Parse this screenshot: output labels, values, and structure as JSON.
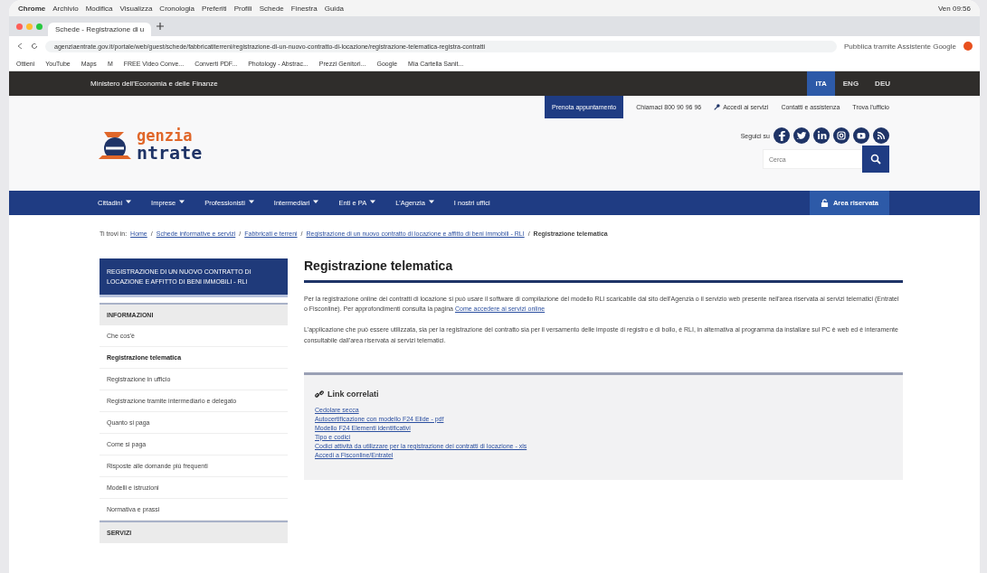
{
  "browser": {
    "menu": [
      "Chrome",
      "Archivio",
      "Modifica",
      "Visualizza",
      "Cronologia",
      "Preferiti",
      "Profili",
      "Schede",
      "Finestra",
      "Guida"
    ],
    "clock": "Ven 09:56",
    "tab_title": "Schede - Registrazione di u",
    "url": "agenziaentrate.gov.it/portale/web/guest/schede/fabbricatiterreni/registrazione-di-un-nuovo-contratto-di-locazione/registrazione-telematica-registra-contratti",
    "url_note": "Pubblica tramite Assistente Google",
    "bookmarks": [
      "Ottieni",
      "YouTube",
      "Maps",
      "M",
      "FREE Video Conve...",
      "Converti PDF...",
      "Photology - Abstrac...",
      "Prezzi Genitori...",
      "Google",
      "Mia Cartella Sanit..."
    ]
  },
  "top_bar": {
    "ministry": "Ministero dell'Economia e delle Finanze",
    "languages": [
      {
        "label": "ITA",
        "selected": true
      },
      {
        "label": "ENG",
        "selected": false
      },
      {
        "label": "DEU",
        "selected": false
      }
    ]
  },
  "header": {
    "logo_top": "genzia",
    "logo_bottom": "ntrate",
    "links": [
      {
        "label": "Prenota appuntamento",
        "kind": "primary"
      },
      {
        "label": "Chiamaci 800 90 96 96",
        "kind": "plain"
      },
      {
        "label": "Accedi ai servizi",
        "kind": "key"
      },
      {
        "label": "Contatti e assistenza",
        "kind": "plain"
      },
      {
        "label": "Trova l'ufficio",
        "kind": "plain"
      }
    ],
    "follow_label": "Seguici su",
    "search_placeholder": "Cerca"
  },
  "nav": {
    "items": [
      {
        "label": "Cittadini",
        "dropdown": true
      },
      {
        "label": "Imprese",
        "dropdown": true
      },
      {
        "label": "Professionisti",
        "dropdown": true
      },
      {
        "label": "Intermediari",
        "dropdown": true
      },
      {
        "label": "Enti e PA",
        "dropdown": true
      },
      {
        "label": "L'Agenzia",
        "dropdown": true
      },
      {
        "label": "I nostri uffici",
        "dropdown": false
      }
    ],
    "reserved": "Area riservata"
  },
  "breadcrumb": {
    "prefix": "Ti trovi in:",
    "separator": "/",
    "items": [
      "Home",
      "Schede informative e servizi",
      "Fabbricati e terreni",
      "Registrazione di un nuovo contratto di locazione e affitto di beni immobili - RLI",
      "Registrazione telematica"
    ]
  },
  "sidebar": {
    "title": "REGISTRAZIONE DI UN NUOVO CONTRATTO DI LOCAZIONE E AFFITTO DI BENI IMMOBILI - RLI",
    "sections": [
      {
        "heading": "INFORMAZIONI",
        "items": [
          {
            "label": "Che cos'è",
            "selected": false
          },
          {
            "label": "Registrazione telematica",
            "selected": true
          },
          {
            "label": "Registrazione in ufficio",
            "selected": false
          },
          {
            "label": "Registrazione tramite intermediario e delegato",
            "selected": false
          },
          {
            "label": "Quanto si paga",
            "selected": false
          },
          {
            "label": "Come si paga",
            "selected": false
          },
          {
            "label": "Risposte alle domande più frequenti",
            "selected": false
          },
          {
            "label": "Modelli e istruzioni",
            "selected": false
          },
          {
            "label": "Normativa e prassi",
            "selected": false
          }
        ]
      },
      {
        "heading": "SERVIZI"
      }
    ]
  },
  "main": {
    "title": "Registrazione telematica",
    "paragraphs": [
      {
        "text": "Per la registrazione online dei contratti di locazione si può usare il software di compilazione del modello RLI scaricabile dal sito dell'Agenzia o il servizio web presente nell'area riservata ai servizi telematici (Entratel o Fisconline). Per approfondimenti consulta la pagina",
        "link": "Come accedere ai servizi online"
      },
      {
        "text": "L'applicazione che può essere utilizzata, sia per la registrazione del contratto sia per il versamento delle imposte di registro e di bollo, è RLI, in alternativa al programma da installare sul PC è web ed è interamente consultabile dall'area riservata ai servizi telematici."
      }
    ],
    "related": {
      "title": "Link correlati",
      "links": [
        "Cedolare secca",
        "Autocertificazione con modello F24 Elide - pdf",
        "Modello F24 Elementi identificativi",
        "Tipo e codici",
        "Codici attività da utilizzare per la registrazione dei contratti di locazione - xls",
        "Accedi a Fisconline/Entratel"
      ]
    }
  }
}
